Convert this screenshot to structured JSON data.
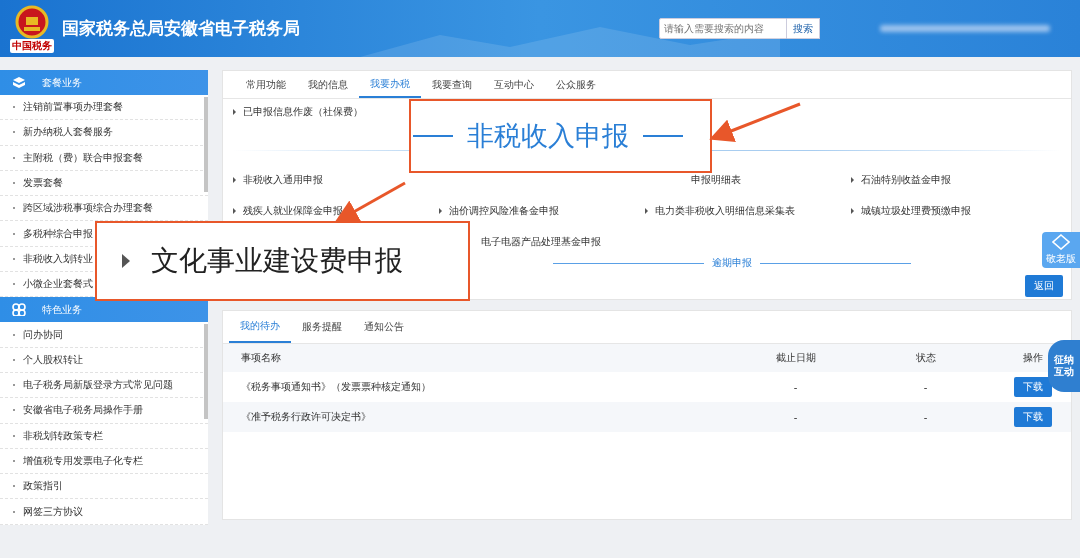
{
  "header": {
    "title": "国家税务总局安徽省电子税务局",
    "logo_caption": "中国税务",
    "search": {
      "placeholder": "请输入需要搜索的内容",
      "button": "搜索"
    }
  },
  "sidebar": {
    "sections": [
      {
        "title": "套餐业务",
        "items": [
          "注销前置事项办理套餐",
          "新办纳税人套餐服务",
          "主附税（费）联合申报套餐",
          "发票套餐",
          "跨区域涉税事项综合办理套餐",
          "多税种综合申报",
          "非税收入划转业",
          "小微企业套餐式"
        ]
      },
      {
        "title": "特色业务",
        "items": [
          "问办协同",
          "个人股权转让",
          "电子税务局新版登录方式常见问题",
          "安徽省电子税务局操作手册",
          "非税划转政策专栏",
          "增值税专用发票电子化专栏",
          "政策指引",
          "网签三方协议"
        ]
      }
    ]
  },
  "main_tabs": [
    {
      "label": "常用功能",
      "selected": false
    },
    {
      "label": "我的信息",
      "selected": false
    },
    {
      "label": "我要办税",
      "selected": true
    },
    {
      "label": "我要查询",
      "selected": false
    },
    {
      "label": "互动中心",
      "selected": false
    },
    {
      "label": "公众服务",
      "selected": false
    }
  ],
  "declare_panel": {
    "prior_items": [
      "已申报信息作废（社保费）"
    ],
    "rows": [
      [
        {
          "text": "非税收入通用申报"
        },
        null,
        {
          "text": "申报明细表",
          "kind": "partial"
        },
        {
          "text": "石油特别收益金申报"
        }
      ],
      [
        {
          "text": "残疾人就业保障金申报"
        },
        {
          "text": "油价调控风险准备金申报"
        },
        {
          "text": "电力类非税收入明细信息采集表"
        },
        {
          "text": "城镇垃圾处理费预缴申报"
        }
      ],
      [
        null,
        {
          "text": "电子电器产品处理基金申报",
          "kind": "partial"
        },
        null,
        null
      ]
    ],
    "overdue_title": "逾期申报",
    "back_button": "返回"
  },
  "todo_panel": {
    "tabs": [
      {
        "label": "我的待办",
        "selected": true
      },
      {
        "label": "服务提醒",
        "selected": false
      },
      {
        "label": "通知公告",
        "selected": false
      }
    ],
    "columns": [
      "事项名称",
      "截止日期",
      "状态",
      "操作"
    ],
    "rows": [
      {
        "name": "《税务事项通知书》（发票票种核定通知）",
        "deadline": "-",
        "status": "-",
        "action": "下载"
      },
      {
        "name": "《准予税务行政许可决定书》",
        "deadline": "-",
        "status": "-",
        "action": "下载"
      }
    ]
  },
  "callouts": [
    {
      "kind": "heading",
      "text": "非税收入申报"
    },
    {
      "kind": "item",
      "text": "文化事业建设费申报"
    }
  ],
  "float_buttons": {
    "elder_mode": "敬老版",
    "assistant": "征纳互动"
  }
}
